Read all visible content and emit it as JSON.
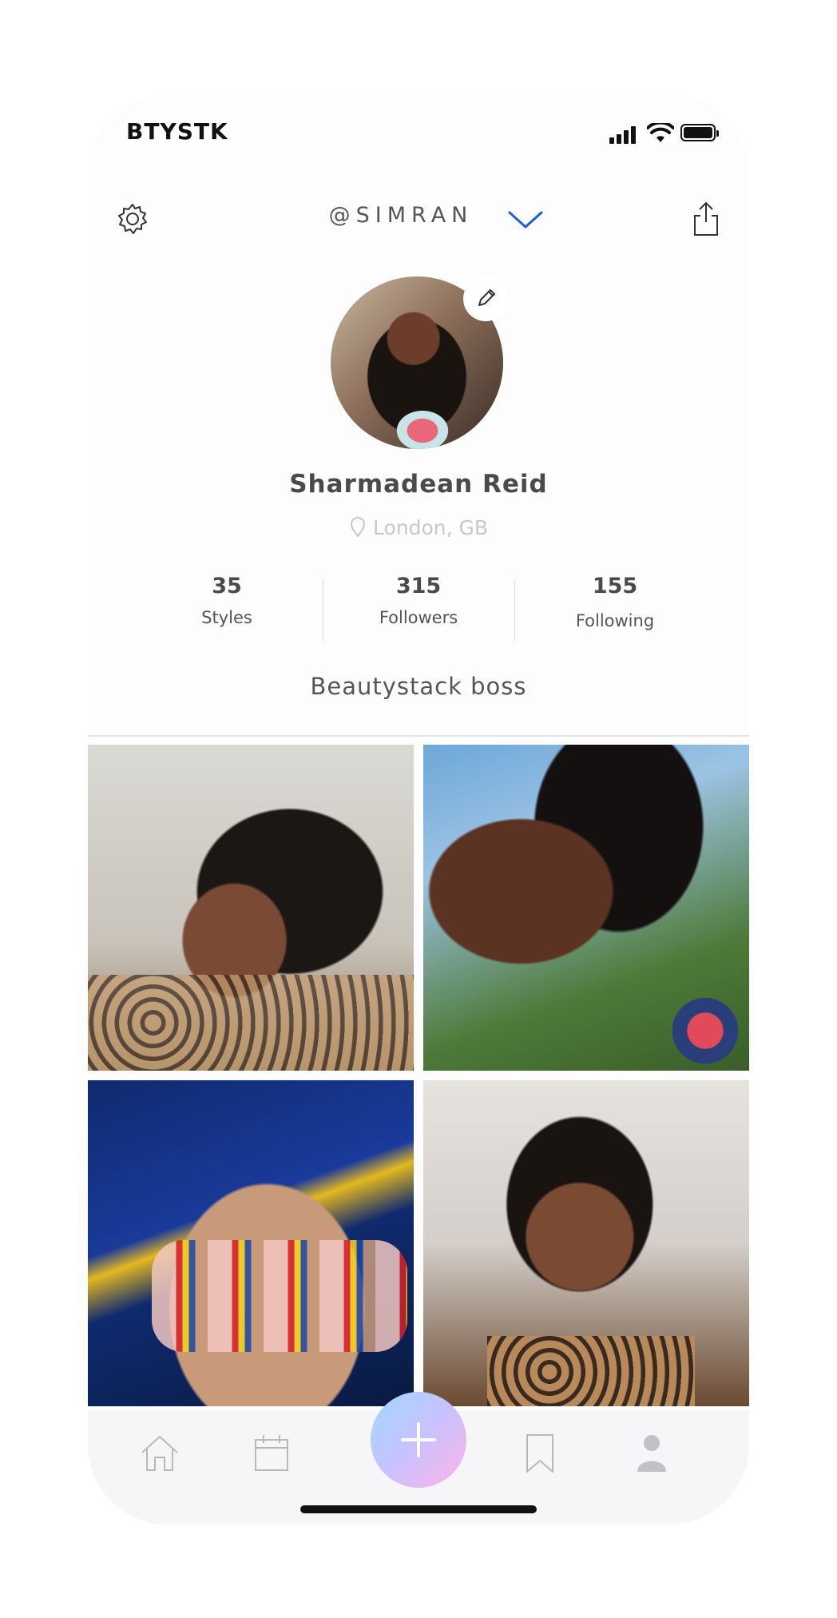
{
  "status_bar": {
    "carrier": "BTYSTK"
  },
  "header": {
    "username": "@SIMRAN"
  },
  "profile": {
    "name": "Sharmadean Reid",
    "location": "London, GB",
    "bio": "Beautystack boss"
  },
  "stats": [
    {
      "value": "35",
      "label": "Styles"
    },
    {
      "value": "315",
      "label": "Followers"
    },
    {
      "value": "155",
      "label": "Following"
    }
  ],
  "icons": {
    "settings": "gear-icon",
    "dropdown": "chevron-down-icon",
    "share": "share-icon",
    "edit": "pencil-icon",
    "location": "location-pin-icon",
    "tabs": [
      "home-icon",
      "calendar-icon",
      "plus-icon",
      "bookmark-icon",
      "profile-icon"
    ]
  },
  "colors": {
    "accent": "#1f5fd6",
    "text": "#4a4a4a",
    "muted": "#c8c8cc",
    "fab_gradient": [
      "#9fd8ff",
      "#c8c2ff",
      "#ffb3e6"
    ]
  }
}
